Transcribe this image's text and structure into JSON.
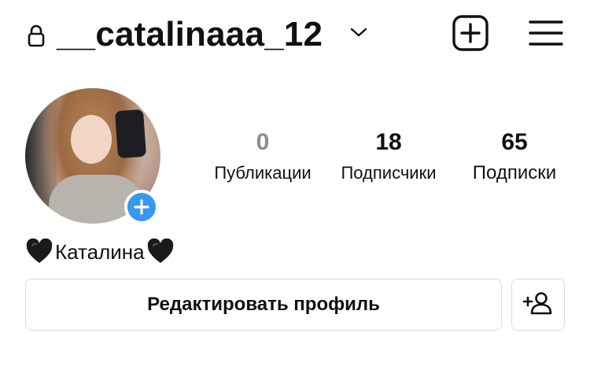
{
  "header": {
    "username": "__catalinaaa_12",
    "icons": [
      "lock-icon",
      "chevron-down-icon",
      "add-post-icon",
      "menu-icon"
    ]
  },
  "profile": {
    "display_name": "Каталина",
    "name_emoji": "black-heart"
  },
  "stats": [
    {
      "value": "0",
      "label": "Публикации"
    },
    {
      "value": "18",
      "label": "Подписчики"
    },
    {
      "value": "65",
      "label": "Подписки"
    }
  ],
  "actions": {
    "edit_profile_label": "Редактировать профиль",
    "add_user_icon": "add-user-icon"
  },
  "colors": {
    "accent_blue": "#3897f0",
    "border": "#dbdbdb",
    "muted": "#8e8e8e",
    "text": "#111111"
  }
}
